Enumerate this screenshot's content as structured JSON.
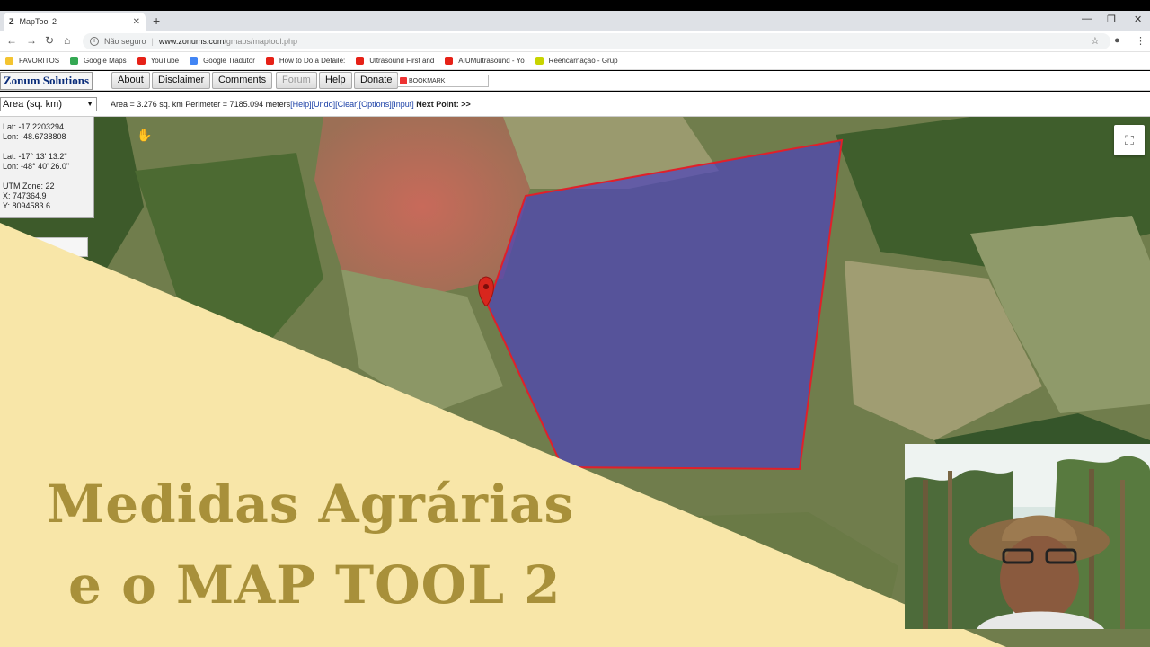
{
  "browser": {
    "tab_title": "MapTool 2",
    "tab_favicon": "Z",
    "new_tab": "+",
    "address_security": "Não seguro",
    "address_host": "www.zonums.com",
    "address_path": "/gmaps/maptool.php"
  },
  "bookmarks": [
    {
      "label": "FAVORITOS",
      "color": "#f4c430"
    },
    {
      "label": "Google Maps",
      "color": "#34a853"
    },
    {
      "label": "YouTube",
      "color": "#e62117"
    },
    {
      "label": "Google Tradutor",
      "color": "#4285f4"
    },
    {
      "label": "How to Do a Detaile:",
      "color": "#e62117"
    },
    {
      "label": "Ultrasound First and",
      "color": "#e62117"
    },
    {
      "label": "AIUMultrasound - Yo",
      "color": "#e62117"
    },
    {
      "label": "Reencarnação - Grup",
      "color": "#c8d400"
    }
  ],
  "toolbar": {
    "brand": "Zonum Solutions",
    "about": "About",
    "disclaimer": "Disclaimer",
    "comments": "Comments",
    "forum": "Forum",
    "help": "Help",
    "donate": "Donate",
    "bookmark": "BOOKMARK"
  },
  "measure": {
    "mode": "Area (sq. km)",
    "readout": "Area = 3.276 sq. km Perimeter = 7185.094 meters",
    "links": [
      "[Help]",
      "[Undo]",
      "[Clear]",
      "[Options]",
      "[Input]"
    ],
    "next_point": "Next Point: >>"
  },
  "coords": {
    "lat_dec": "Lat: -17.2203294",
    "lon_dec": "Lon: -48.6738808",
    "lat_dms": "Lat: -17° 13' 13.2\"",
    "lon_dms": "Lon: -48° 40' 26.0\"",
    "utm_zone": "UTM Zone: 22",
    "utm_x": "X: 747364.9",
    "utm_y": "Y: 8094583.6"
  },
  "overlay": {
    "line1": "Medidas Agrárias",
    "line2": "e o MAP TOOL 2"
  },
  "colors": {
    "banner": "#f8e6a8",
    "headline": "#a8903a",
    "polygon_fill": "#4a3fc0",
    "polygon_stroke": "#e0202a"
  }
}
